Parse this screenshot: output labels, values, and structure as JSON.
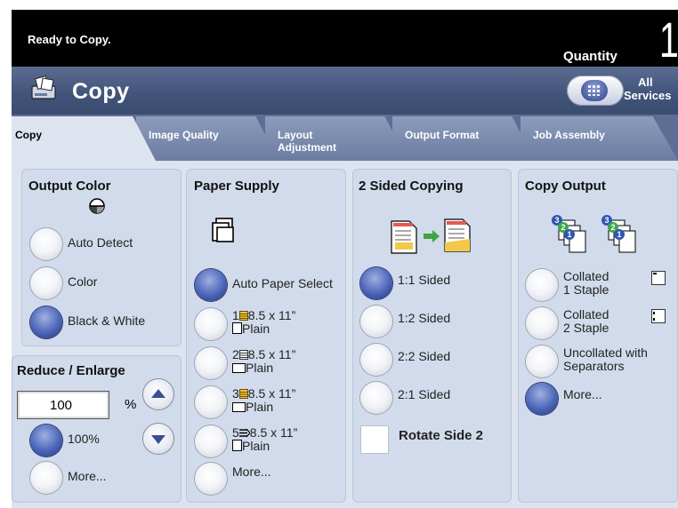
{
  "status": {
    "message": "Ready to Copy.",
    "quantity_label": "Quantity",
    "quantity_value": "1"
  },
  "app": {
    "title": "Copy",
    "all_services_line1": "All",
    "all_services_line2": "Services"
  },
  "tabs": [
    {
      "label": "Copy",
      "active": true
    },
    {
      "label": "Image Quality"
    },
    {
      "label_line1": "Layout",
      "label_line2": "Adjustment"
    },
    {
      "label": "Output Format"
    },
    {
      "label": "Job Assembly"
    }
  ],
  "output_color": {
    "title": "Output Color",
    "options": [
      {
        "label": "Auto Detect",
        "selected": false
      },
      {
        "label": "Color",
        "selected": false
      },
      {
        "label": "Black & White",
        "selected": true
      }
    ]
  },
  "reduce_enlarge": {
    "title": "Reduce / Enlarge",
    "value": "100",
    "unit": "%",
    "options": [
      {
        "label": "100%",
        "selected": true
      },
      {
        "label": "More...",
        "selected": false
      }
    ]
  },
  "paper_supply": {
    "title": "Paper Supply",
    "options": [
      {
        "label": "Auto Paper Select",
        "selected": true
      },
      {
        "tray": "1",
        "size": "8.5 x 11”",
        "type": "Plain",
        "selected": false
      },
      {
        "tray": "2",
        "size": "8.5 x 11”",
        "type": "Plain",
        "selected": false
      },
      {
        "tray": "3",
        "size": "8.5 x 11”",
        "type": "Plain",
        "selected": false
      },
      {
        "tray": "5",
        "size": "8.5 x 11”",
        "type": "Plain",
        "selected": false
      },
      {
        "label": "More...",
        "selected": false
      }
    ]
  },
  "two_sided": {
    "title": "2 Sided Copying",
    "options": [
      {
        "label": "1:1 Sided",
        "selected": true
      },
      {
        "label": "1:2 Sided",
        "selected": false
      },
      {
        "label": "2:2 Sided",
        "selected": false
      },
      {
        "label": "2:1 Sided",
        "selected": false
      }
    ],
    "rotate_label": "Rotate Side 2"
  },
  "copy_output": {
    "title": "Copy Output",
    "options": [
      {
        "line1": "Collated",
        "line2": "1 Staple",
        "selected": false
      },
      {
        "line1": "Collated",
        "line2": "2 Staple",
        "selected": false
      },
      {
        "line1": "Uncollated with",
        "line2": "Separators",
        "selected": false
      },
      {
        "label": "More...",
        "selected": true
      }
    ]
  },
  "colors": {
    "status_bg": "#000000",
    "appbar": "#415378",
    "panel": "#d1dbeb",
    "selected_radio": "#3a52a6"
  }
}
